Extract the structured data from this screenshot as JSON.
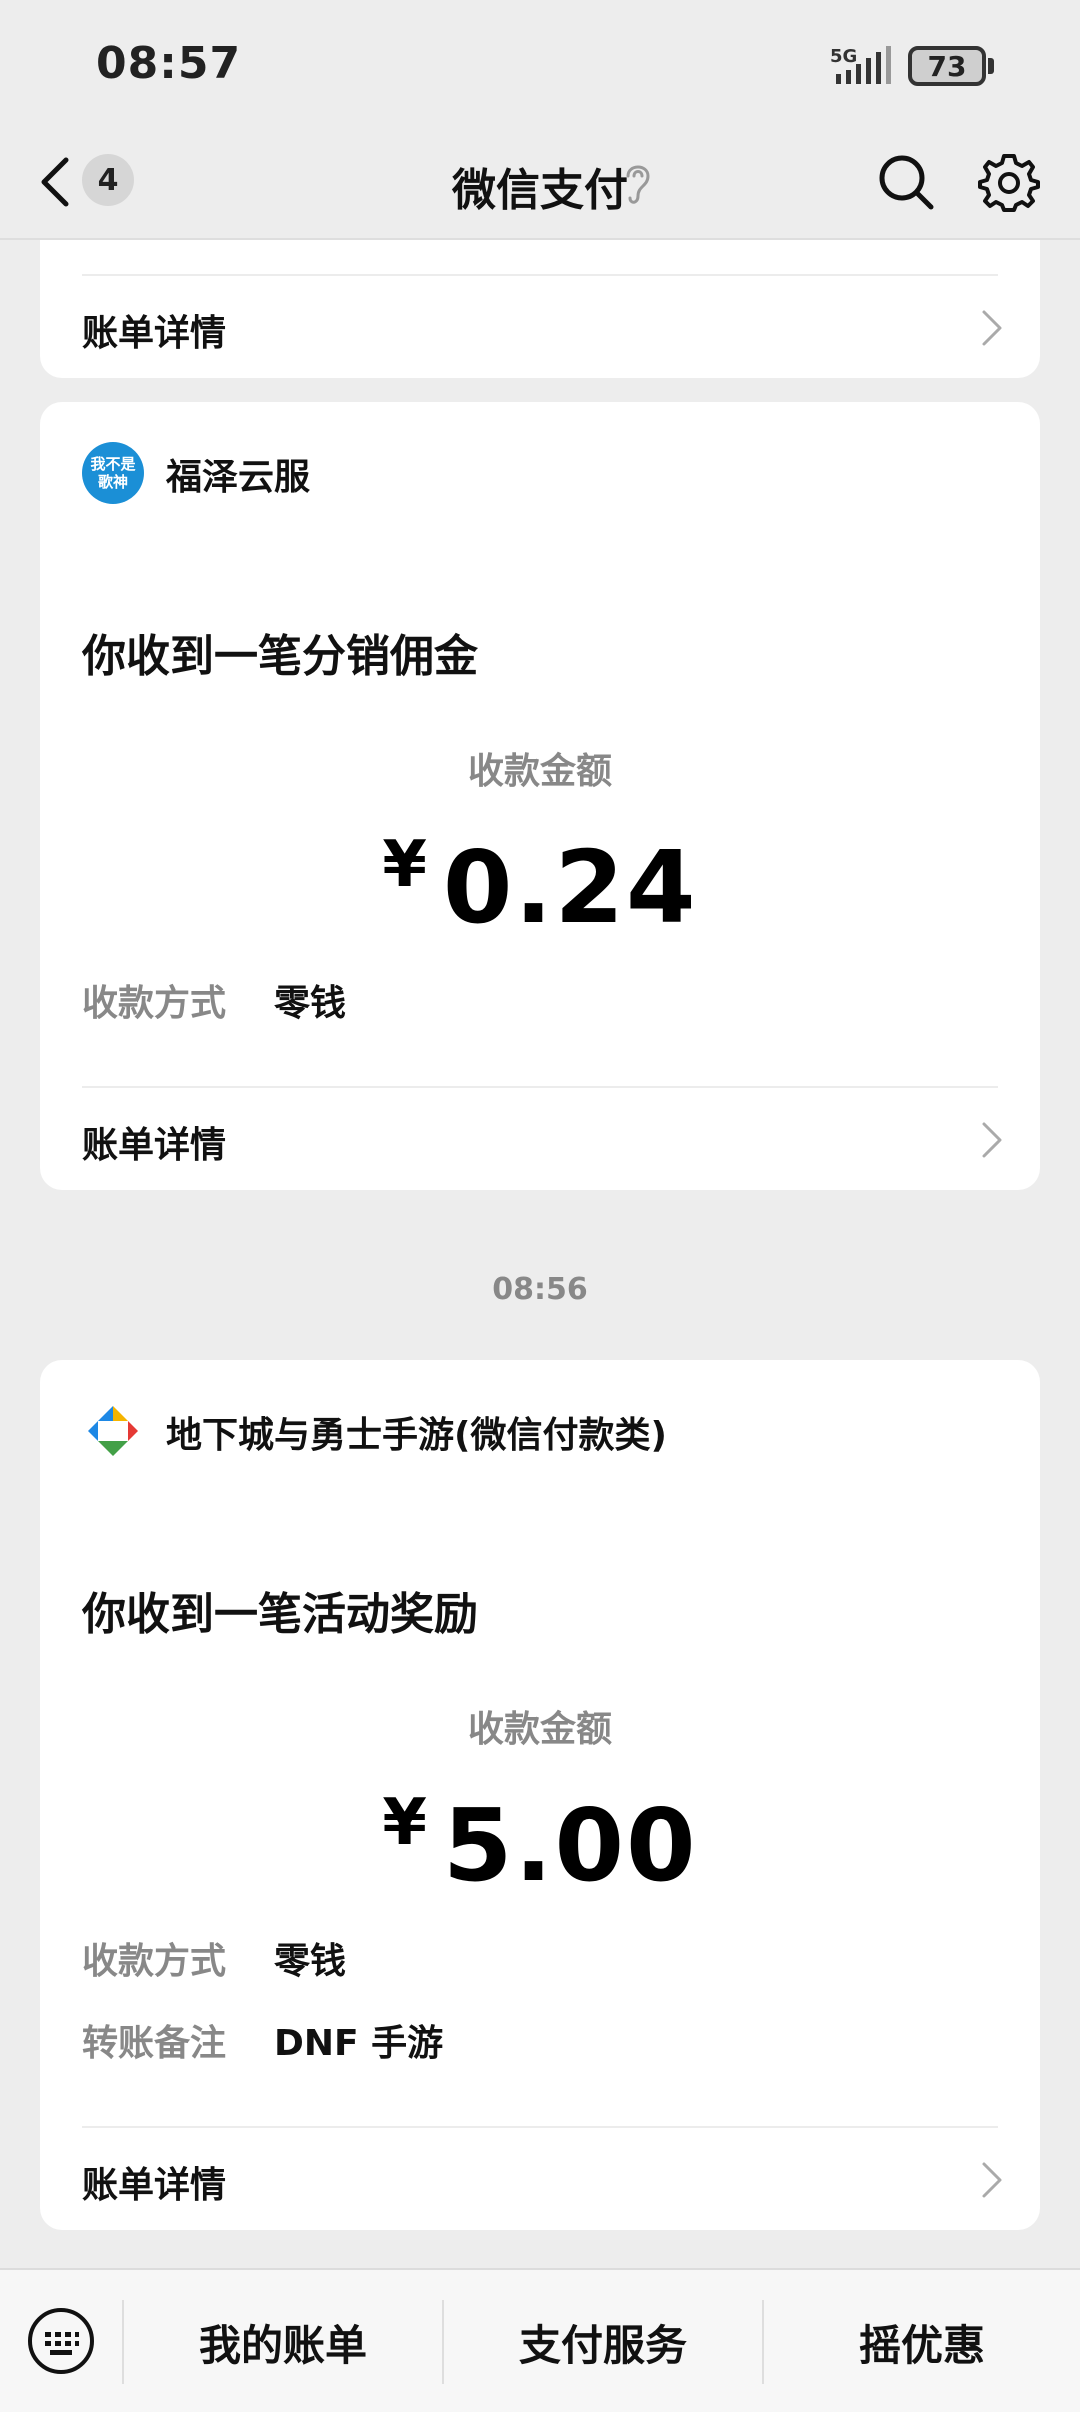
{
  "status_bar": {
    "time": "08:57",
    "network": "5G",
    "battery": "73"
  },
  "nav": {
    "unread_count": "4",
    "title": "微信支付"
  },
  "top_card": {
    "detail_label": "账单详情"
  },
  "card1": {
    "merchant_logo_text": "我不是歌神",
    "merchant_name": "福泽云服",
    "notice": "你收到一笔分销佣金",
    "amount_label": "收款金额",
    "currency": "¥",
    "amount": "0.24",
    "method_key": "收款方式",
    "method_value": "零钱",
    "detail_label": "账单详情"
  },
  "timestamp": "08:56",
  "card2": {
    "merchant_name": "地下城与勇士手游(微信付款类)",
    "notice": "你收到一笔活动奖励",
    "amount_label": "收款金额",
    "currency": "¥",
    "amount": "5.00",
    "method_key": "收款方式",
    "method_value": "零钱",
    "remark_key": "转账备注",
    "remark_value": "DNF 手游",
    "detail_label": "账单详情"
  },
  "bottom_bar": {
    "tabs": [
      "我的账单",
      "支付服务",
      "摇优惠"
    ]
  },
  "icons": {
    "back": "chevron-left-icon",
    "search": "search-icon",
    "settings": "gear-icon",
    "mute": "ear-icon",
    "keyboard": "keyboard-icon",
    "detail": "chevron-right-icon"
  }
}
